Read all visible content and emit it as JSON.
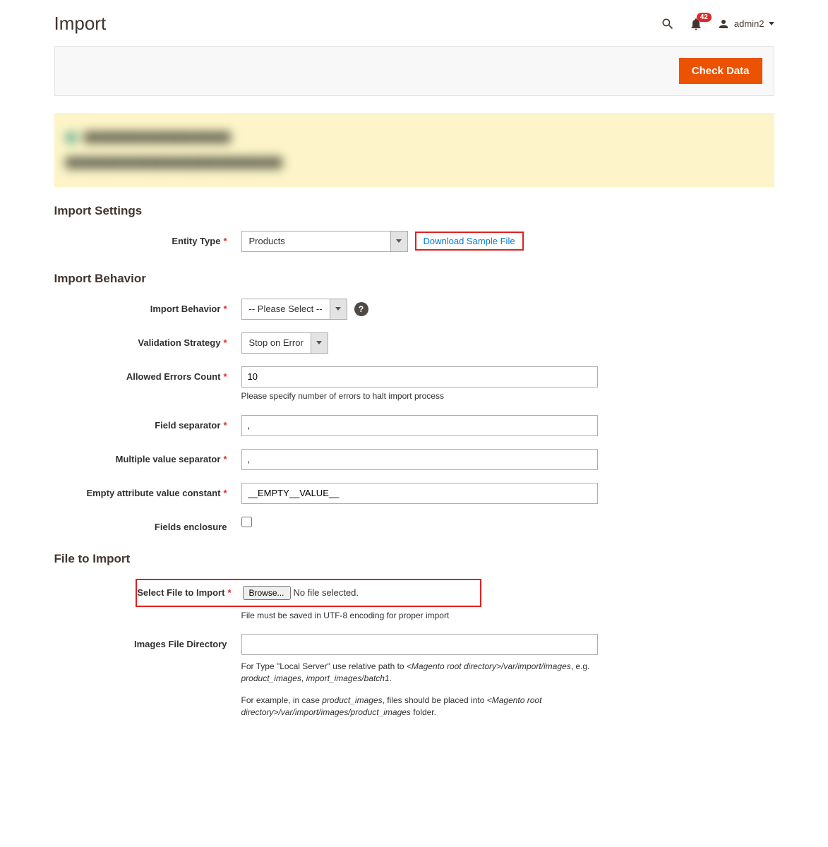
{
  "header": {
    "title": "Import",
    "notification_count": "42",
    "user_name": "admin2"
  },
  "actions": {
    "check_data": "Check Data"
  },
  "sections": {
    "import_settings": {
      "title": "Import Settings",
      "entity_type": {
        "label": "Entity Type",
        "value": "Products",
        "download_link": "Download Sample File"
      }
    },
    "import_behavior": {
      "title": "Import Behavior",
      "behavior": {
        "label": "Import Behavior",
        "value": "-- Please Select --"
      },
      "validation": {
        "label": "Validation Strategy",
        "value": "Stop on Error"
      },
      "allowed_errors": {
        "label": "Allowed Errors Count",
        "value": "10",
        "note": "Please specify number of errors to halt import process"
      },
      "field_separator": {
        "label": "Field separator",
        "value": ","
      },
      "multi_separator": {
        "label": "Multiple value separator",
        "value": ","
      },
      "empty_const": {
        "label": "Empty attribute value constant",
        "value": "__EMPTY__VALUE__"
      },
      "fields_enclosure": {
        "label": "Fields enclosure"
      }
    },
    "file_import": {
      "title": "File to Import",
      "select_file": {
        "label": "Select File to Import",
        "browse": "Browse...",
        "status": "No file selected.",
        "note": "File must be saved in UTF-8 encoding for proper import"
      },
      "images_dir": {
        "label": "Images File Directory",
        "value": "",
        "note1_a": "For Type \"Local Server\" use relative path to ",
        "note1_b": "<Magento root directory>/var/import/images",
        "note1_c": ", e.g. ",
        "note1_d": "product_images",
        "note1_e": ", ",
        "note1_f": "import_images/batch1",
        "note1_g": ".",
        "note2_a": "For example, in case ",
        "note2_b": "product_images",
        "note2_c": ", files should be placed into ",
        "note2_d": "<Magento root directory>/var/import/images/product_images",
        "note2_e": " folder."
      }
    }
  }
}
